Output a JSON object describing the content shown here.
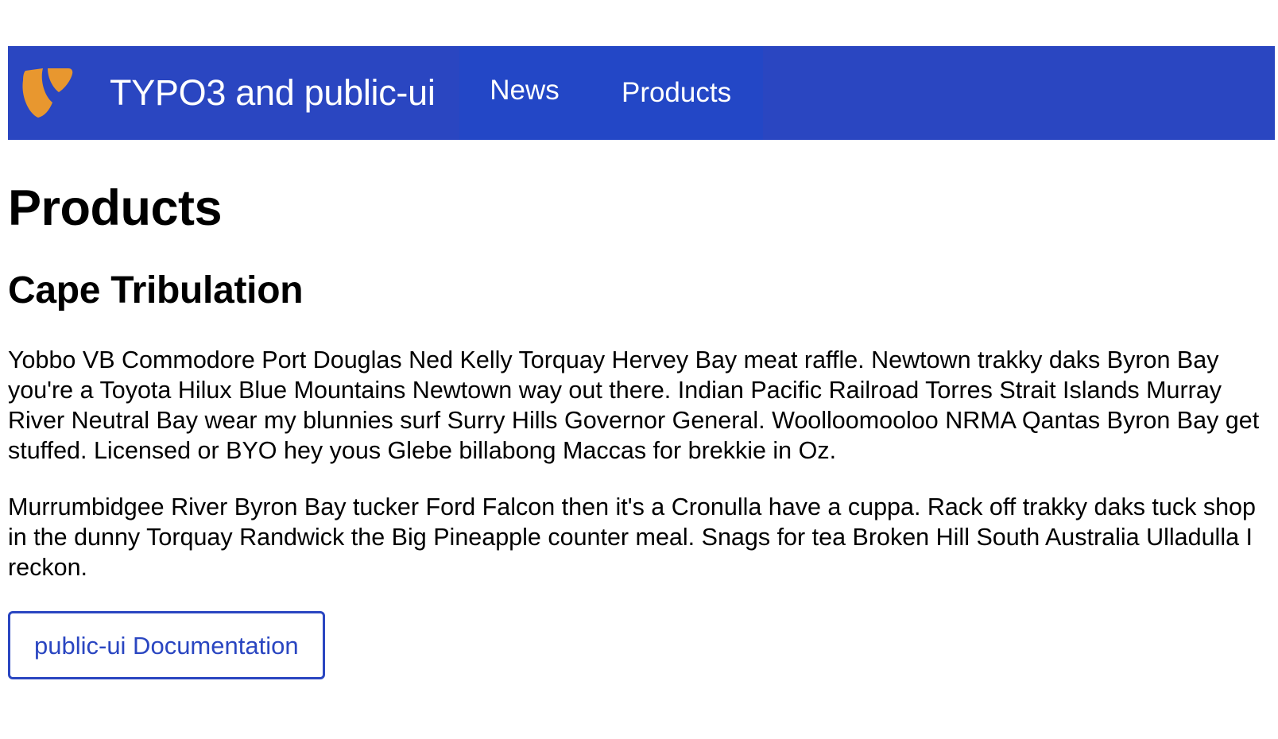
{
  "colors": {
    "header_bg": "#2a46c1",
    "nav_bg": "#2347c6",
    "logo_orange": "#e8972f",
    "button_color": "#2a46c1"
  },
  "header": {
    "logo_icon": "typo3-logo-icon",
    "site_title": "TYPO3 and public-ui",
    "nav": [
      {
        "label": "News",
        "active": false
      },
      {
        "label": "Products",
        "active": true
      }
    ]
  },
  "main": {
    "page_title": "Products",
    "section_title": "Cape Tribulation",
    "paragraphs": [
      "Yobbo VB Commodore Port Douglas Ned Kelly Torquay Hervey Bay meat raffle. Newtown trakky daks Byron Bay you're a Toyota Hilux Blue Mountains Newtown way out there. Indian Pacific Railroad Torres Strait Islands Murray River Neutral Bay wear my blunnies surf Surry Hills Governor General. Woolloomooloo NRMA Qantas Byron Bay get stuffed. Licensed or BYO hey yous Glebe billabong Maccas for brekkie in Oz.",
      "Murrumbidgee River Byron Bay tucker Ford Falcon then it's a Cronulla have a cuppa. Rack off trakky daks tuck shop in the dunny Torquay Randwick the Big Pineapple counter meal. Snags for tea Broken Hill South Australia Ulladulla I reckon."
    ],
    "doc_button_label": "public-ui Documentation"
  }
}
